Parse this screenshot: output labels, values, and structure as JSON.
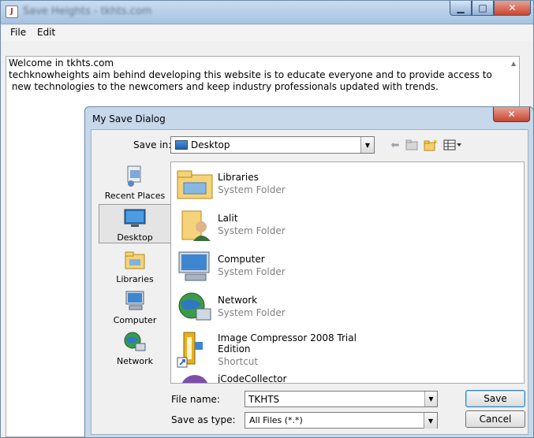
{
  "main_window": {
    "title": "Save Heights - tkhts.com",
    "menu": {
      "file": "File",
      "edit": "Edit"
    },
    "editor_text": "Welcome in tkhts.com\ntechknowheights aim behind developing this website is to educate everyone and to provide access to\n new technologies to the newcomers and keep industry professionals updated with trends."
  },
  "dialog": {
    "title": "My Save Dialog",
    "save_in": {
      "label": "Save in:",
      "value": "Desktop"
    },
    "places": [
      {
        "label": "Recent Places",
        "icon": "recent-places-icon"
      },
      {
        "label": "Desktop",
        "icon": "desktop-icon"
      },
      {
        "label": "Libraries",
        "icon": "libraries-icon"
      },
      {
        "label": "Computer",
        "icon": "computer-icon"
      },
      {
        "label": "Network",
        "icon": "network-icon"
      }
    ],
    "files": [
      {
        "name": "Libraries",
        "type": "System Folder",
        "icon": "libraries-folder-icon"
      },
      {
        "name": "Lalit",
        "type": "System Folder",
        "icon": "user-folder-icon"
      },
      {
        "name": "Computer",
        "type": "System Folder",
        "icon": "computer-icon"
      },
      {
        "name": "Network",
        "type": "System Folder",
        "icon": "network-icon"
      },
      {
        "name": "Image Compressor 2008 Trial",
        "name2": "Edition",
        "type": "Shortcut",
        "icon": "shortcut-icon"
      },
      {
        "name": "jCodeCollector",
        "type": "",
        "icon": "app-icon"
      }
    ],
    "file_name": {
      "label": "File name:",
      "value": "TKHTS"
    },
    "save_as_type": {
      "label": "Save as type:",
      "value": "All Files (*.*)"
    },
    "buttons": {
      "save": "Save",
      "cancel": "Cancel"
    },
    "colors": {
      "accent": "#3c7fb1",
      "titlebar": "#c6d8ea"
    }
  }
}
